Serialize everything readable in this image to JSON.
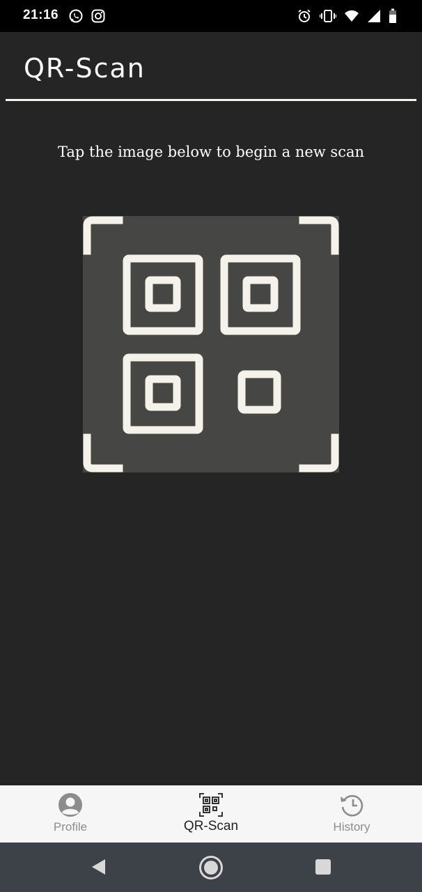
{
  "status_bar": {
    "time": "21:16",
    "left_icons": [
      "whatsapp-icon",
      "instagram-icon"
    ],
    "right_icons": [
      "alarm-icon",
      "vibrate-icon",
      "wifi-icon",
      "signal-icon",
      "battery-icon"
    ]
  },
  "header": {
    "title": "QR-Scan"
  },
  "main": {
    "instruction": "Tap the image below to begin a new scan",
    "scan_button_icon": "qr-code-icon"
  },
  "bottom_nav": {
    "items": [
      {
        "label": "Profile",
        "icon": "profile-icon",
        "active": false
      },
      {
        "label": "QR-Scan",
        "icon": "qr-scan-icon",
        "active": true
      },
      {
        "label": "History",
        "icon": "history-icon",
        "active": false
      }
    ]
  },
  "system_nav": {
    "buttons": [
      "back-icon",
      "home-icon",
      "recents-icon"
    ]
  },
  "colors": {
    "background": "#252525",
    "status_bar": "#000000",
    "scan_tile": "#464644",
    "qr_stroke": "#f4f2ea",
    "nav_background": "#f6f6f6",
    "nav_active_text": "#222222",
    "nav_inactive_text": "#8c8c8c",
    "system_nav": "#3c4248"
  }
}
